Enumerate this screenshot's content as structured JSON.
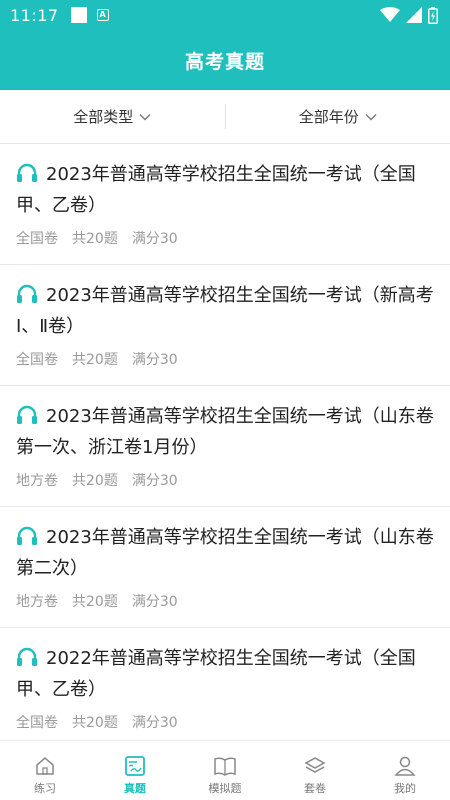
{
  "status": {
    "time": "11:17"
  },
  "header": {
    "title": "高考真题"
  },
  "filters": {
    "type_label": "全部类型",
    "year_label": "全部年份"
  },
  "items": [
    {
      "title": "2023年普通高等学校招生全国统一考试（全国甲、乙卷）",
      "category": "全国卷",
      "count": "共20题",
      "score": "满分30"
    },
    {
      "title": "2023年普通高等学校招生全国统一考试（新高考Ⅰ、Ⅱ卷）",
      "category": "全国卷",
      "count": "共20题",
      "score": "满分30"
    },
    {
      "title": "2023年普通高等学校招生全国统一考试（山东卷第一次、浙江卷1月份）",
      "category": "地方卷",
      "count": "共20题",
      "score": "满分30"
    },
    {
      "title": "2023年普通高等学校招生全国统一考试（山东卷第二次）",
      "category": "地方卷",
      "count": "共20题",
      "score": "满分30"
    },
    {
      "title": "2022年普通高等学校招生全国统一考试（全国甲、乙卷）",
      "category": "全国卷",
      "count": "共20题",
      "score": "满分30"
    }
  ],
  "nav": [
    {
      "label": "练习",
      "icon": "home-icon"
    },
    {
      "label": "真题",
      "icon": "exam-paper-icon",
      "active": true
    },
    {
      "label": "模拟题",
      "icon": "book-icon"
    },
    {
      "label": "套卷",
      "icon": "layers-icon"
    },
    {
      "label": "我的",
      "icon": "person-icon"
    }
  ],
  "colors": {
    "accent": "#1fbfbd"
  }
}
